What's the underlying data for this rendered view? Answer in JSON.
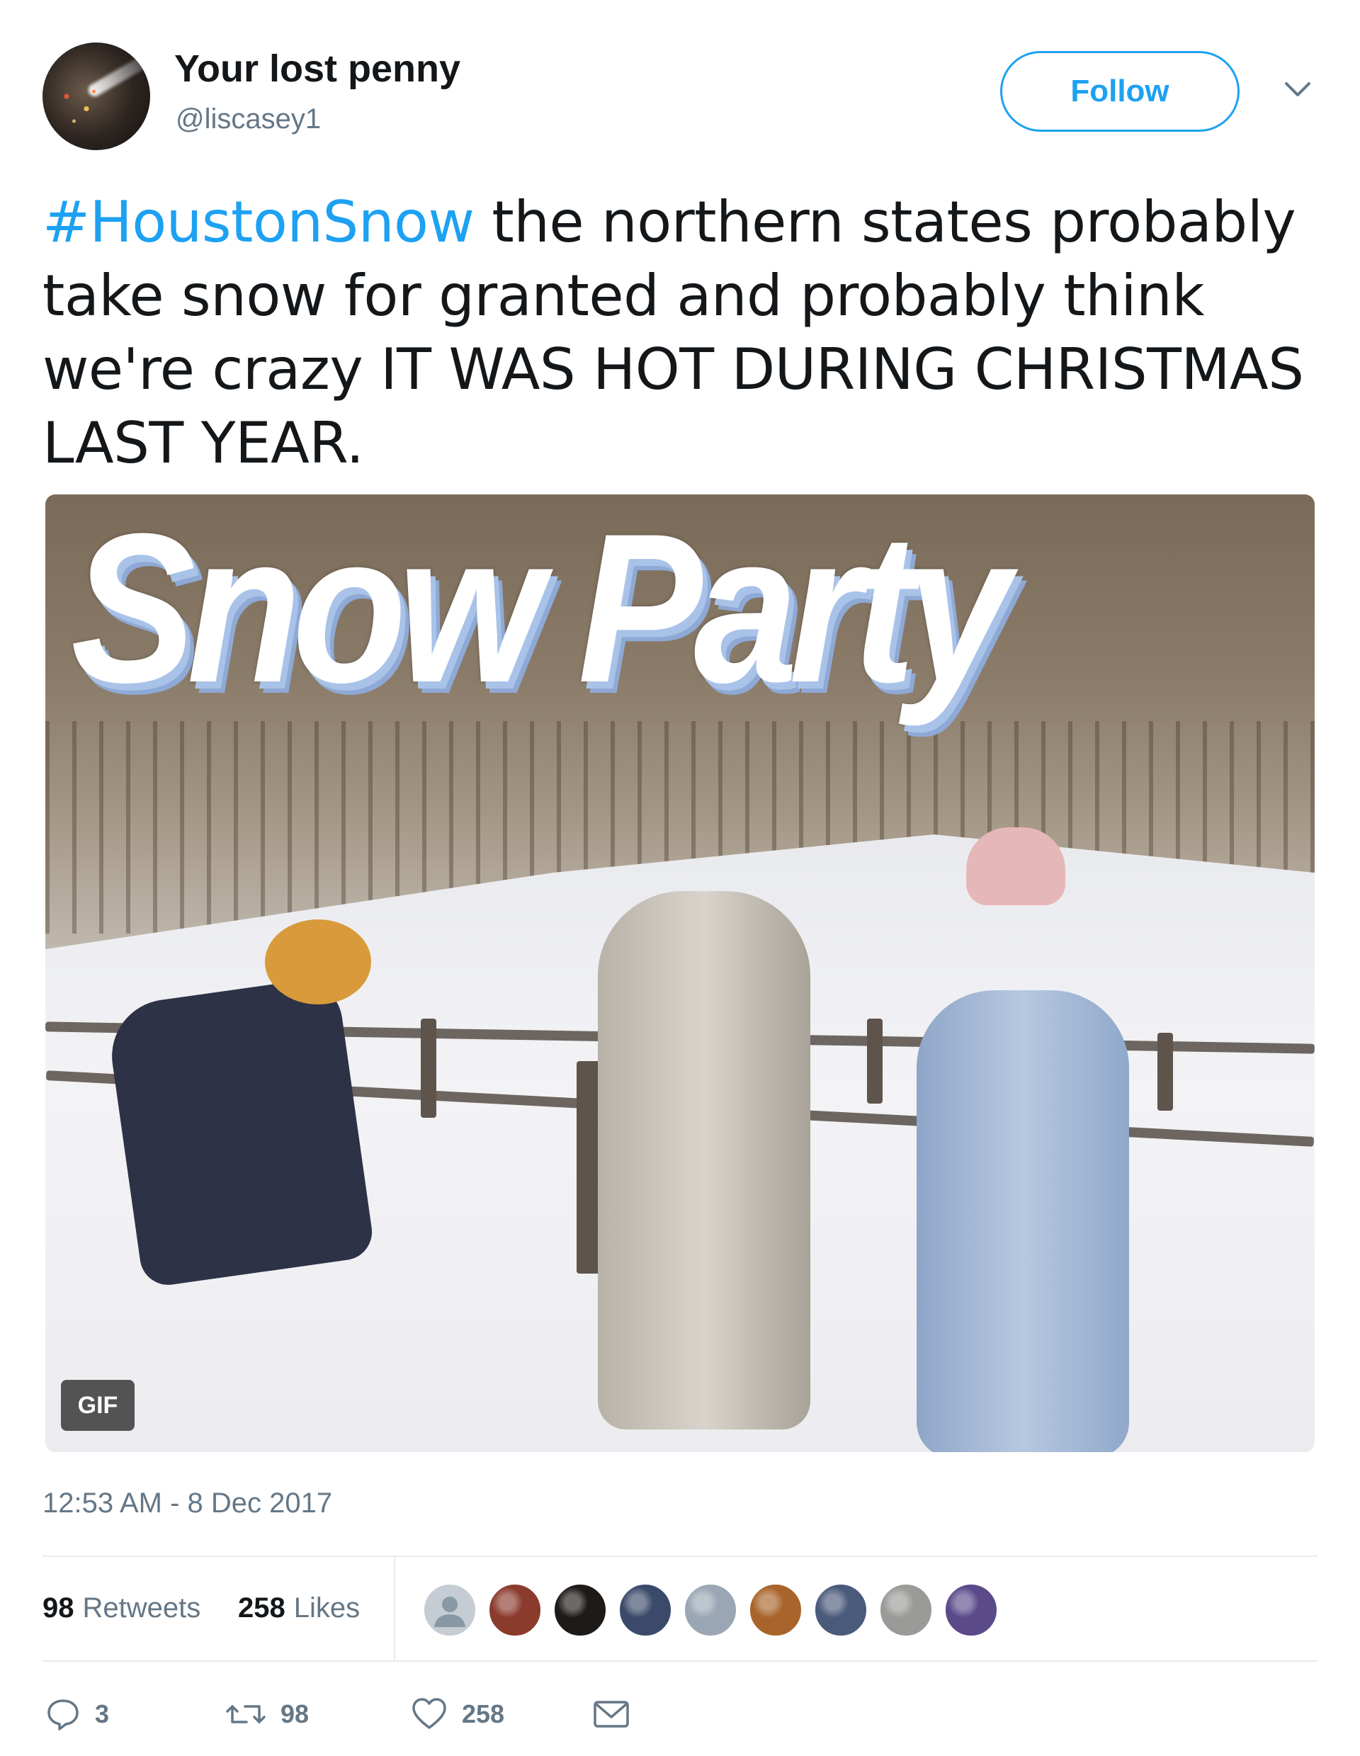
{
  "author": {
    "display_name": "Your lost penny",
    "handle": "@liscasey1",
    "follow_label": "Follow"
  },
  "tweet": {
    "hashtag": "#HoustonSnow",
    "body": " the northern states probably take snow for granted and probably think we're crazy IT WAS HOT DURING CHRISTMAS LAST YEAR."
  },
  "media": {
    "caption_text": "Snow Party",
    "badge": "GIF"
  },
  "timestamp": "12:53 AM - 8 Dec 2017",
  "stats": {
    "retweets_count": "98",
    "retweets_label": "Retweets",
    "likes_count": "258",
    "likes_label": "Likes"
  },
  "liker_avatars": [
    "#c5ccd3",
    "#8a3b2c",
    "#1e1a18",
    "#3b4a6a",
    "#9aa6b4",
    "#a8642a",
    "#4a5a7a",
    "#9a9a98",
    "#5a4a8a"
  ],
  "actions": {
    "reply_count": "3",
    "retweet_count": "98",
    "like_count": "258"
  },
  "colors": {
    "accent": "#1da1f2",
    "text": "#14171a",
    "secondary": "#657786"
  },
  "icons": [
    "chevron-down-icon",
    "reply-icon",
    "retweet-icon",
    "heart-icon",
    "envelope-icon",
    "default-avatar-icon"
  ]
}
